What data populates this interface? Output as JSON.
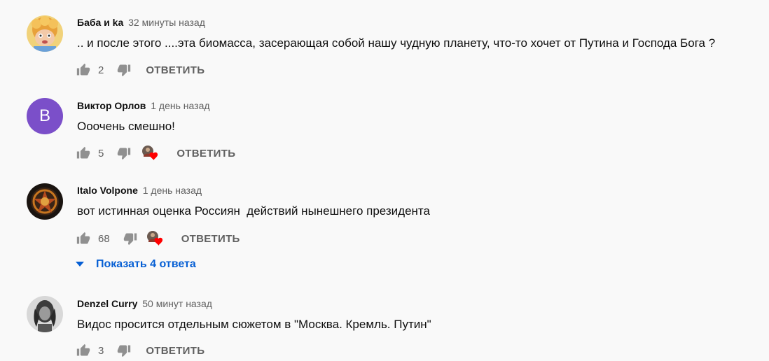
{
  "colors": {
    "background": "#f9f9f9",
    "secondary_text": "#606060",
    "link_blue": "#065fd4",
    "heart_red": "#ff0000",
    "letter_avatar_bg": "#7b4fc9"
  },
  "comments": [
    {
      "author": "Баба и ka",
      "time": "32 минуты назад",
      "text": ".. и после этого ....эта биомасса, засерающая собой нашу чудную планету, что-то хочет от Путина и Господа Бога ?",
      "likes": "2",
      "reply_label": "ОТВЕТИТЬ",
      "avatar_icon": "cartoon-character-avatar",
      "creator_heart": false
    },
    {
      "author": "Виктор Орлов",
      "time": "1 день назад",
      "text": "Ооочень смешно!",
      "likes": "5",
      "reply_label": "ОТВЕТИТЬ",
      "avatar_letter": "В",
      "creator_heart": true
    },
    {
      "author": "Italo Volpone",
      "time": "1 день назад",
      "text": "вот истинная оценка Россиян  действий нынешнего президента",
      "likes": "68",
      "reply_label": "ОТВЕТИТЬ",
      "avatar_icon": "dark-emblem-avatar",
      "creator_heart": true,
      "replies_toggle": "Показать 4 ответа"
    },
    {
      "author": "Denzel Curry",
      "time": "50 минут назад",
      "text": "Видос просится отдельным сюжетом в \"Москва. Кремль. Путин\"",
      "likes": "3",
      "reply_label": "ОТВЕТИТЬ",
      "avatar_icon": "bw-portrait-avatar",
      "creator_heart": false
    }
  ]
}
